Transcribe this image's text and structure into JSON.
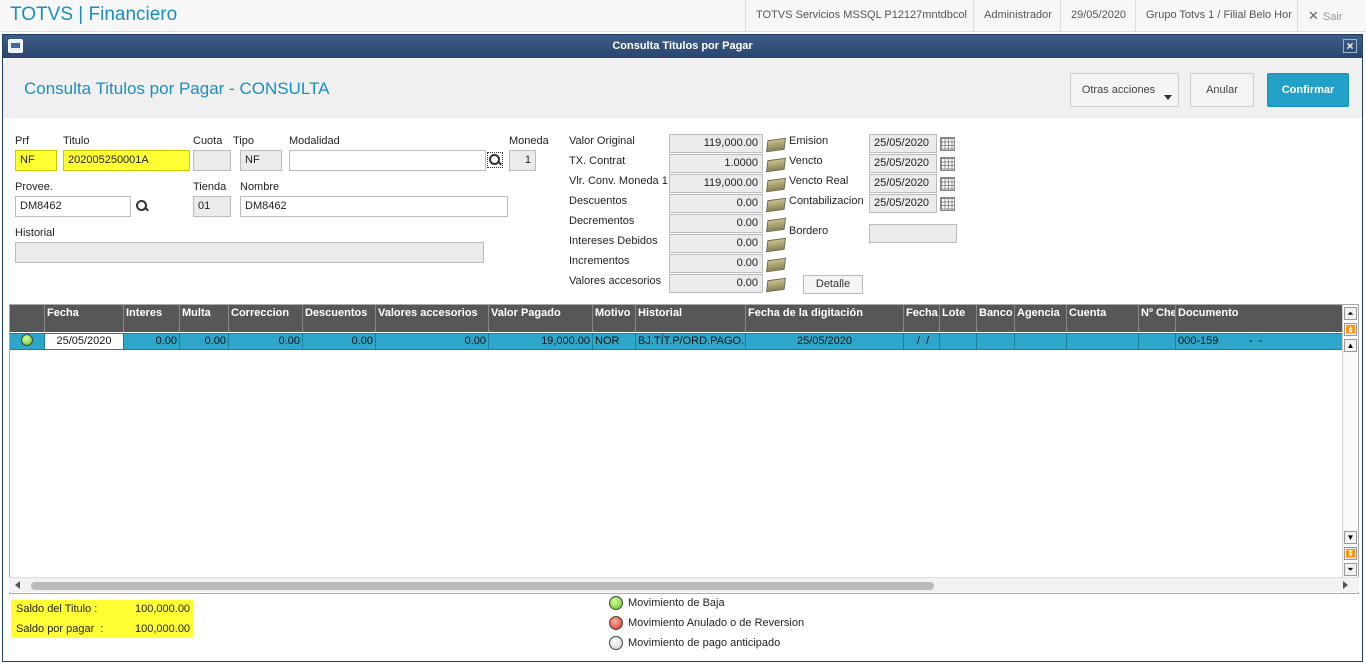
{
  "app": {
    "brand": "TOTVS | Financiero",
    "server": "TOTVS Servicios MSSQL P12127mntdbcol",
    "user": "Administrador",
    "date": "29/05/2020",
    "branch": "Grupo Totvs 1 / Filial Belo Hor",
    "exit_label": "Sair",
    "exit_glyph": "✕"
  },
  "window": {
    "title": "Consulta Titulos por Pagar",
    "close_glyph": "×"
  },
  "header": {
    "title": "Consulta Titulos por Pagar - CONSULTA",
    "actions_label": "Otras acciones",
    "cancel_label": "Anular",
    "confirm_label": "Confirmar"
  },
  "form": {
    "prf_label": "Prf",
    "prf_value": "NF",
    "titulo_label": "Titulo",
    "titulo_value": "202005250001A",
    "cuota_label": "Cuota",
    "cuota_value": "",
    "tipo_label": "Tipo",
    "tipo_value": "NF",
    "modalidad_label": "Modalidad",
    "modalidad_value": "",
    "moneda_label": "Moneda",
    "moneda_value": "1",
    "provee_label": "Provee.",
    "provee_value": "DM8462",
    "tienda_label": "Tienda",
    "tienda_value": "01",
    "nombre_label": "Nombre",
    "nombre_value": "DM8462",
    "historial_label": "Historial",
    "historial_value": ""
  },
  "values": {
    "valor_original_label": "Valor Original",
    "valor_original": "119,000.00",
    "tx_contrat_label": "TX. Contrat",
    "tx_contrat": "1.0000",
    "vlr_conv_label": "Vlr. Conv. Moneda 1",
    "vlr_conv": "119,000.00",
    "descuentos_label": "Descuentos",
    "descuentos": "0.00",
    "decrementos_label": "Decrementos",
    "decrementos": "0.00",
    "intereses_label": "Intereses Debidos",
    "intereses": "0.00",
    "incrementos_label": "Incrementos",
    "incrementos": "0.00",
    "accesorios_label": "Valores accesorios",
    "accesorios": "0.00",
    "detalle_label": "Detalle"
  },
  "dates": {
    "emision_label": "Emision",
    "emision": "25/05/2020",
    "vencto_label": "Vencto",
    "vencto": "25/05/2020",
    "vencto_real_label": "Vencto Real",
    "vencto_real": "25/05/2020",
    "contab_label": "Contabilizacion",
    "contab": "25/05/2020",
    "bordero_label": "Bordero",
    "bordero": ""
  },
  "grid": {
    "columns": [
      "",
      "Fecha",
      "Interes",
      "Multa",
      "Correccion",
      "Descuentos",
      "Valores accesorios",
      "Valor Pagado",
      "Motivo",
      "Historial",
      "Fecha de la digitación",
      "Fecha",
      "Lote",
      "Banco",
      "Agencia",
      "Cuenta",
      "Nº Che",
      "Documento"
    ],
    "rows": [
      {
        "status": "green",
        "fecha": "25/05/2020",
        "interes": "0.00",
        "multa": "0.00",
        "correccion": "0.00",
        "descuentos": "0.00",
        "accesorios": "0.00",
        "valor_pagado": "19,000.00",
        "motivo": "NOR",
        "historial": "BJ.TÍT.P/ORD.PAGO.",
        "fecha_digitacion": "25/05/2020",
        "fecha2": " /  /",
        "lote": "",
        "banco": "",
        "agencia": "",
        "cuenta": "",
        "cheque": "",
        "documento": "000-159          -  -"
      }
    ]
  },
  "summary": {
    "saldo_titulo_label": "Saldo del Titulo :",
    "saldo_titulo": "100,000.00",
    "saldo_pagar_label": "Saldo por pagar  :",
    "saldo_pagar": "100,000.00"
  },
  "legend": {
    "baja": "Movimiento de Baja",
    "anulado": "Movimiento Anulado o de Reversion",
    "anticipado": "Movimiento de pago anticipado"
  }
}
